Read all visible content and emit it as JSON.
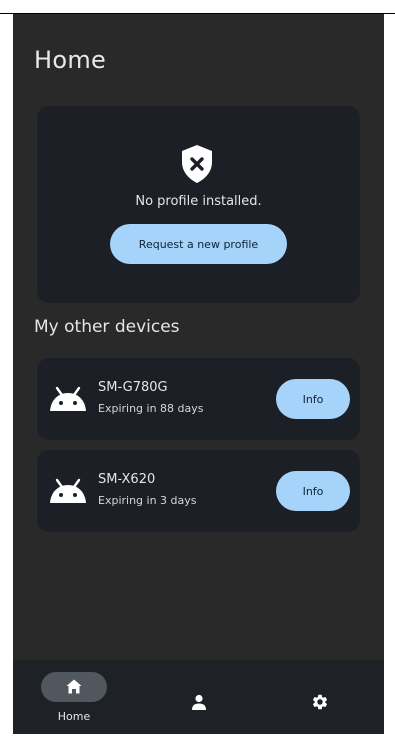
{
  "page": {
    "title": "Home"
  },
  "profile_card": {
    "icon": "shield-x-icon",
    "message": "No profile installed.",
    "button_label": "Request a new profile"
  },
  "other_devices": {
    "title": "My other devices",
    "items": [
      {
        "icon": "android-icon",
        "name": "SM-G780G",
        "expiry": "Expiring in 88 days",
        "button_label": "Info"
      },
      {
        "icon": "android-icon",
        "name": "SM-X620",
        "expiry": "Expiring in 3 days",
        "button_label": "Info"
      }
    ]
  },
  "bottom_nav": {
    "items": [
      {
        "icon": "home-icon",
        "label": "Home",
        "active": true
      },
      {
        "icon": "person-icon",
        "label": "",
        "active": false
      },
      {
        "icon": "gear-icon",
        "label": "",
        "active": false
      }
    ]
  },
  "colors": {
    "background": "#292929",
    "card": "#1c1f26",
    "accent": "#a6d3fa",
    "nav_bg": "#1e2126",
    "nav_active_pill": "#51575f"
  }
}
